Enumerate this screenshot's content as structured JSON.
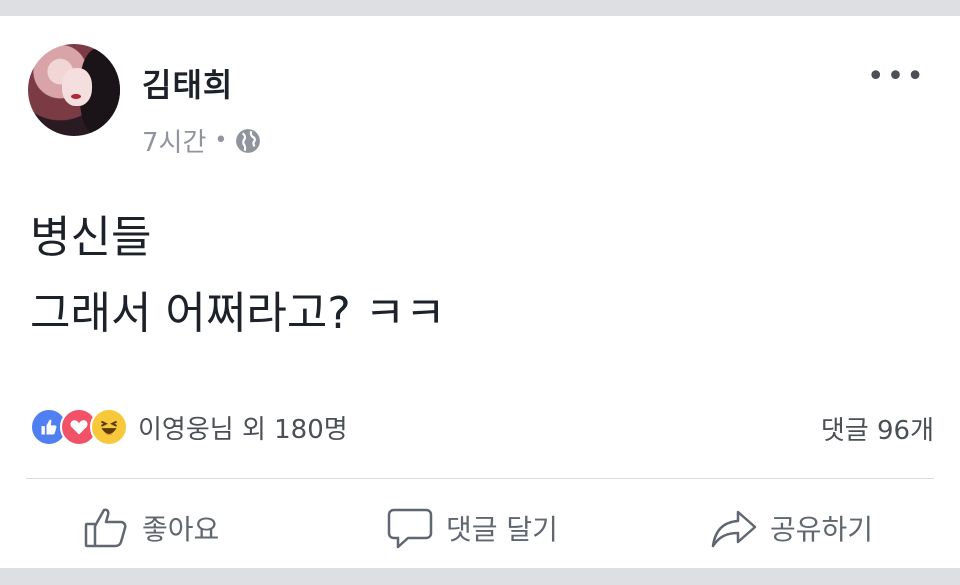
{
  "post": {
    "author_name": "김태희",
    "time": "7시간",
    "separator": "•",
    "privacy_icon": "globe-icon",
    "more_icon": "•••",
    "text_lines": [
      "병신들",
      "그래서 어쩌라고? ㅋㅋ"
    ]
  },
  "reactions": {
    "icons": [
      "like-icon",
      "love-icon",
      "haha-icon"
    ],
    "summary": "이영웅님 외 180명",
    "comments": "댓글 96개"
  },
  "actions": {
    "like": "좋아요",
    "comment": "댓글 달기",
    "share": "공유하기"
  },
  "colors": {
    "like": "#4f7ff0",
    "love": "#f25268",
    "haha": "#f7c93a",
    "text": "#1d2129",
    "muted": "#90949c",
    "action": "#606770"
  }
}
